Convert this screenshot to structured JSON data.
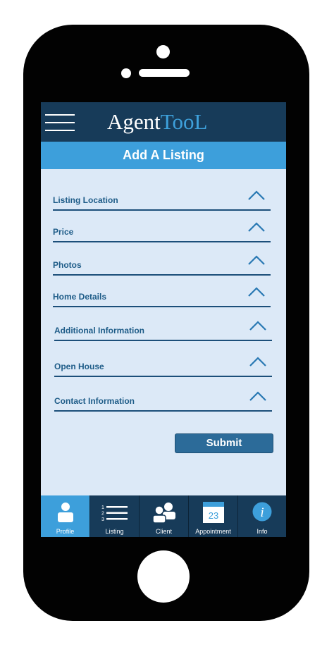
{
  "app": {
    "brand_part1": "Agent",
    "brand_part2": "TooL",
    "page_title": "Add A Listing"
  },
  "sections": [
    {
      "label": "Listing Location"
    },
    {
      "label": "Price"
    },
    {
      "label": "Photos"
    },
    {
      "label": "Home Details"
    },
    {
      "label": "Additional Information"
    },
    {
      "label": "Open House"
    },
    {
      "label": "Contact Information"
    }
  ],
  "submit_label": "Submit",
  "tabs": [
    {
      "label": "Profile",
      "icon": "profile-icon",
      "active": true
    },
    {
      "label": "Listing",
      "icon": "list-icon",
      "active": false
    },
    {
      "label": "Client",
      "icon": "clients-icon",
      "active": false
    },
    {
      "label": "Appointment",
      "icon": "calendar-icon",
      "active": false,
      "day": "23"
    },
    {
      "label": "Info",
      "icon": "info-icon",
      "active": false
    }
  ],
  "colors": {
    "header": "#173b59",
    "accent": "#3d9fdb",
    "screen_bg": "#dce9f7",
    "label": "#1e5c88",
    "submit": "#2c6b99"
  }
}
